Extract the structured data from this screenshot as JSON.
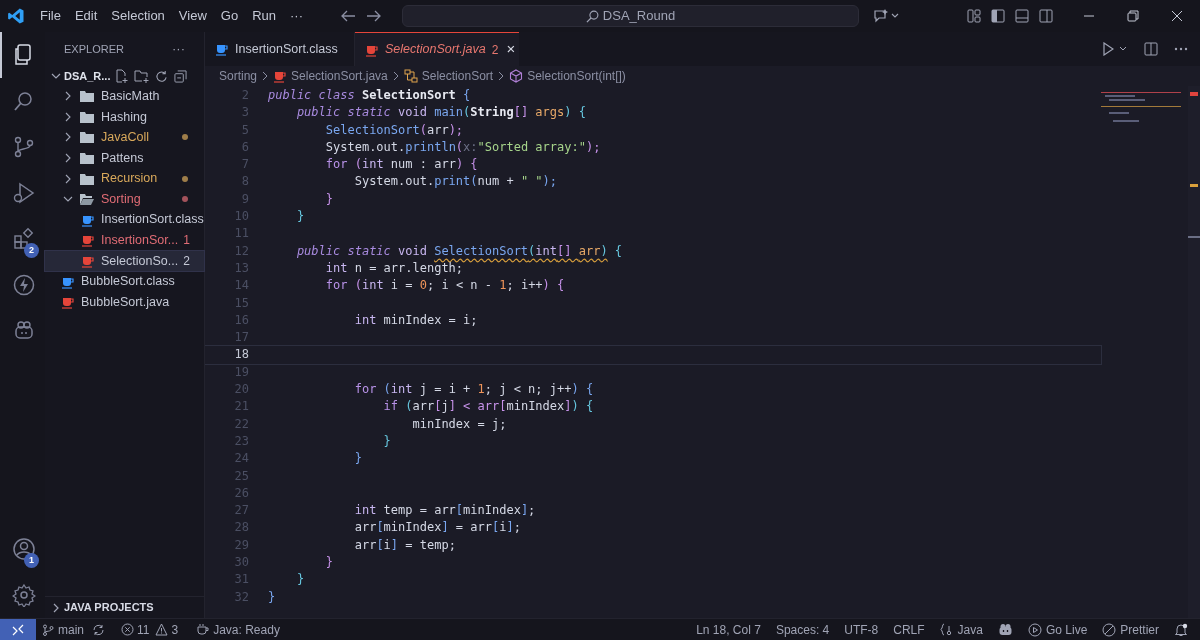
{
  "menu": [
    "File",
    "Edit",
    "Selection",
    "View",
    "Go",
    "Run",
    "···"
  ],
  "search": {
    "value": "DSA_Round"
  },
  "activity": [
    {
      "kind": "files",
      "selected": true
    },
    {
      "kind": "search",
      "selected": false
    },
    {
      "kind": "git",
      "selected": false
    },
    {
      "kind": "debug",
      "selected": false
    },
    {
      "kind": "extensions",
      "selected": false,
      "badge": "2"
    },
    {
      "kind": "bolt",
      "selected": false
    },
    {
      "kind": "robot",
      "selected": false
    }
  ],
  "activity_bottom": [
    {
      "kind": "account",
      "badge": "1"
    },
    {
      "kind": "gear"
    }
  ],
  "explorer": {
    "title": "EXPLORER",
    "more": "···",
    "root": "DSA_R...",
    "expanded": true,
    "items": [
      {
        "label": "BasicMath",
        "kind": "folder",
        "expanded": false,
        "color": "#c5c9d6",
        "dot": false,
        "selected": false
      },
      {
        "label": "Hashing",
        "kind": "folder",
        "expanded": false,
        "color": "#c5c9d6",
        "dot": false,
        "selected": false
      },
      {
        "label": "JavaColl",
        "kind": "folder",
        "expanded": false,
        "color": "#d9a95b",
        "dot": true,
        "selected": false
      },
      {
        "label": "Pattens",
        "kind": "folder",
        "expanded": false,
        "color": "#c5c9d6",
        "dot": false,
        "selected": false
      },
      {
        "label": "Recursion",
        "kind": "folder",
        "expanded": false,
        "color": "#d9a95b",
        "dot": true,
        "selected": false
      },
      {
        "label": "Sorting",
        "kind": "folder",
        "expanded": true,
        "color": "#e06c75",
        "dot": true,
        "selected": false,
        "children": [
          {
            "label": "InsertionSort.class",
            "kind": "class",
            "color": "#c5c9d6",
            "selected": false
          },
          {
            "label": "InsertionSor...",
            "kind": "java",
            "color": "#e06c75",
            "badge": "1",
            "selected": false
          },
          {
            "label": "SelectionSo...",
            "kind": "java",
            "color": "#c5c9d6",
            "badge": "2",
            "selected": true
          }
        ]
      },
      {
        "label": "BubbleSort.class",
        "kind": "class",
        "color": "#c5c9d6",
        "dot": false,
        "selected": false
      },
      {
        "label": "BubbleSort.java",
        "kind": "java",
        "color": "#c5c9d6",
        "dot": false,
        "selected": false
      }
    ],
    "java_projects": "JAVA PROJECTS"
  },
  "tabs": [
    {
      "label": "InsertionSort.class",
      "kind": "class",
      "selected": false
    },
    {
      "label": "SelectionSort.java",
      "kind": "java",
      "selected": true,
      "badge": "2",
      "close": "×"
    }
  ],
  "breadcrumbs": [
    {
      "label": "Sorting",
      "kind": "folder"
    },
    {
      "label": "SelectionSort.java",
      "kind": "java"
    },
    {
      "label": "SelectionSort",
      "kind": "class"
    },
    {
      "label": "SelectionSort(int[])",
      "kind": "method"
    }
  ],
  "code": [
    {
      "n": "2",
      "current": false,
      "tokens": [
        {
          "text": "public class ",
          "kind": "kw"
        },
        {
          "text": "SelectionSort",
          "kind": "cls"
        },
        {
          "text": " {",
          "kind": "b1"
        }
      ]
    },
    {
      "n": "3",
      "current": false,
      "tokens": [
        {
          "text": "    public static ",
          "kind": "kw"
        },
        {
          "text": "void ",
          "kind": "typ"
        },
        {
          "text": "main",
          "kind": "fn"
        },
        {
          "text": "(",
          "kind": "b2"
        },
        {
          "text": "String",
          "kind": "cls"
        },
        {
          "text": "[] ",
          "kind": "b3"
        },
        {
          "text": "args",
          "kind": "param"
        },
        {
          "text": ") {",
          "kind": "b2"
        }
      ]
    },
    {
      "n": "5",
      "current": false,
      "tokens": [
        {
          "text": "        SelectionSort",
          "kind": "fn"
        },
        {
          "text": "(",
          "kind": "b3"
        },
        {
          "text": "arr",
          "kind": "var"
        },
        {
          "text": ");",
          "kind": "b3"
        }
      ]
    },
    {
      "n": "6",
      "current": false,
      "tokens": [
        {
          "text": "        System.out.",
          "kind": "var"
        },
        {
          "text": "println",
          "kind": "fn"
        },
        {
          "text": "(",
          "kind": "b3"
        },
        {
          "text": "x:",
          "kind": "hint"
        },
        {
          "text": "\"Sorted array:\"",
          "kind": "str"
        },
        {
          "text": ");",
          "kind": "b3"
        }
      ]
    },
    {
      "n": "7",
      "current": false,
      "tokens": [
        {
          "text": "        for ",
          "kind": "kw2"
        },
        {
          "text": "(",
          "kind": "b3"
        },
        {
          "text": "int ",
          "kind": "typ"
        },
        {
          "text": "num : arr",
          "kind": "var"
        },
        {
          "text": ") {",
          "kind": "b3"
        }
      ]
    },
    {
      "n": "8",
      "current": false,
      "tokens": [
        {
          "text": "            System.out.",
          "kind": "var"
        },
        {
          "text": "print",
          "kind": "fn"
        },
        {
          "text": "(",
          "kind": "b1"
        },
        {
          "text": "num + ",
          "kind": "var"
        },
        {
          "text": "\" \"",
          "kind": "str"
        },
        {
          "text": ");",
          "kind": "b1"
        }
      ]
    },
    {
      "n": "9",
      "current": false,
      "tokens": [
        {
          "text": "        }",
          "kind": "b3"
        }
      ]
    },
    {
      "n": "10",
      "current": false,
      "tokens": [
        {
          "text": "    }",
          "kind": "b2"
        }
      ]
    },
    {
      "n": "11",
      "current": false
    },
    {
      "n": "12",
      "current": false,
      "tokens": [
        {
          "text": "    public static ",
          "kind": "kw"
        },
        {
          "text": "void ",
          "kind": "typ"
        },
        {
          "text": "SelectionSort",
          "kind": "fn",
          "squiggle": true
        },
        {
          "text": "(",
          "kind": "b2",
          "squiggle": true
        },
        {
          "text": "int",
          "kind": "typ",
          "squiggle": true
        },
        {
          "text": "[] ",
          "kind": "b3",
          "squiggle": true
        },
        {
          "text": "arr",
          "kind": "param",
          "squiggle": true
        },
        {
          "text": ")",
          "kind": "b2",
          "squiggle": true
        },
        {
          "text": " {",
          "kind": "b2"
        }
      ]
    },
    {
      "n": "13",
      "current": false,
      "tokens": [
        {
          "text": "        int ",
          "kind": "typ"
        },
        {
          "text": "n = arr.length;",
          "kind": "var"
        }
      ]
    },
    {
      "n": "14",
      "current": false,
      "tokens": [
        {
          "text": "        for ",
          "kind": "kw2"
        },
        {
          "text": "(",
          "kind": "b3"
        },
        {
          "text": "int ",
          "kind": "typ"
        },
        {
          "text": "i = ",
          "kind": "var"
        },
        {
          "text": "0",
          "kind": "num"
        },
        {
          "text": "; i < n - ",
          "kind": "var"
        },
        {
          "text": "1",
          "kind": "num"
        },
        {
          "text": "; i++",
          "kind": "var"
        },
        {
          "text": ") {",
          "kind": "b3"
        }
      ]
    },
    {
      "n": "15",
      "current": false
    },
    {
      "n": "16",
      "current": false,
      "tokens": [
        {
          "text": "            int ",
          "kind": "typ"
        },
        {
          "text": "minIndex = i;",
          "kind": "var"
        }
      ]
    },
    {
      "n": "17",
      "current": false
    },
    {
      "n": "18",
      "current": true
    },
    {
      "n": "19",
      "current": false
    },
    {
      "n": "20",
      "current": false,
      "tokens": [
        {
          "text": "            for ",
          "kind": "kw2"
        },
        {
          "text": "(",
          "kind": "b1"
        },
        {
          "text": "int ",
          "kind": "typ"
        },
        {
          "text": "j = i + ",
          "kind": "var"
        },
        {
          "text": "1",
          "kind": "num"
        },
        {
          "text": "; j < n; j++",
          "kind": "var"
        },
        {
          "text": ") {",
          "kind": "b1"
        }
      ]
    },
    {
      "n": "21",
      "current": false,
      "tokens": [
        {
          "text": "                if ",
          "kind": "kw2"
        },
        {
          "text": "(",
          "kind": "b2"
        },
        {
          "text": "arr",
          "kind": "var"
        },
        {
          "text": "[",
          "kind": "b3"
        },
        {
          "text": "j",
          "kind": "var"
        },
        {
          "text": "] < arr[",
          "kind": "b3"
        },
        {
          "text": "minIndex",
          "kind": "var"
        },
        {
          "text": "]",
          "kind": "b3"
        },
        {
          "text": ") {",
          "kind": "b2"
        }
      ]
    },
    {
      "n": "22",
      "current": false,
      "tokens": [
        {
          "text": "                    minIndex = j;",
          "kind": "var"
        }
      ]
    },
    {
      "n": "23",
      "current": false,
      "tokens": [
        {
          "text": "                }",
          "kind": "b2"
        }
      ]
    },
    {
      "n": "24",
      "current": false,
      "tokens": [
        {
          "text": "            }",
          "kind": "b1"
        }
      ]
    },
    {
      "n": "25",
      "current": false
    },
    {
      "n": "26",
      "current": false
    },
    {
      "n": "27",
      "current": false,
      "tokens": [
        {
          "text": "            int ",
          "kind": "typ"
        },
        {
          "text": "temp = arr",
          "kind": "var"
        },
        {
          "text": "[",
          "kind": "b1"
        },
        {
          "text": "minIndex",
          "kind": "var"
        },
        {
          "text": "]",
          "kind": "b1"
        },
        {
          "text": ";",
          "kind": "var"
        }
      ]
    },
    {
      "n": "28",
      "current": false,
      "tokens": [
        {
          "text": "            arr",
          "kind": "var"
        },
        {
          "text": "[",
          "kind": "b1"
        },
        {
          "text": "minIndex",
          "kind": "var"
        },
        {
          "text": "]",
          "kind": "b1"
        },
        {
          "text": " = arr",
          "kind": "var"
        },
        {
          "text": "[",
          "kind": "b1"
        },
        {
          "text": "i",
          "kind": "var"
        },
        {
          "text": "]",
          "kind": "b1"
        },
        {
          "text": ";",
          "kind": "var"
        }
      ]
    },
    {
      "n": "29",
      "current": false,
      "tokens": [
        {
          "text": "            arr",
          "kind": "var"
        },
        {
          "text": "[",
          "kind": "b1"
        },
        {
          "text": "i",
          "kind": "var"
        },
        {
          "text": "]",
          "kind": "b1"
        },
        {
          "text": " = temp;",
          "kind": "var"
        }
      ]
    },
    {
      "n": "30",
      "current": false,
      "tokens": [
        {
          "text": "        }",
          "kind": "b3"
        }
      ]
    },
    {
      "n": "31",
      "current": false,
      "tokens": [
        {
          "text": "    }",
          "kind": "b2"
        }
      ]
    },
    {
      "n": "32",
      "current": false,
      "tokens": [
        {
          "text": "}",
          "kind": "b1"
        }
      ]
    }
  ],
  "status_bar": {
    "branch": "main",
    "errors": "11",
    "warnings": "3",
    "java": "Java: Ready",
    "right": [
      {
        "kind": "text",
        "label": "Ln 18, Col 7"
      },
      {
        "kind": "text",
        "label": "Spaces: 4"
      },
      {
        "kind": "text",
        "label": "UTF-8"
      },
      {
        "kind": "text",
        "label": "CRLF"
      },
      {
        "kind": "braces",
        "label": "Java"
      },
      {
        "kind": "robot"
      },
      {
        "kind": "golive",
        "label": "Go Live"
      },
      {
        "kind": "prettier",
        "label": "Prettier"
      },
      {
        "kind": "bell"
      }
    ]
  }
}
